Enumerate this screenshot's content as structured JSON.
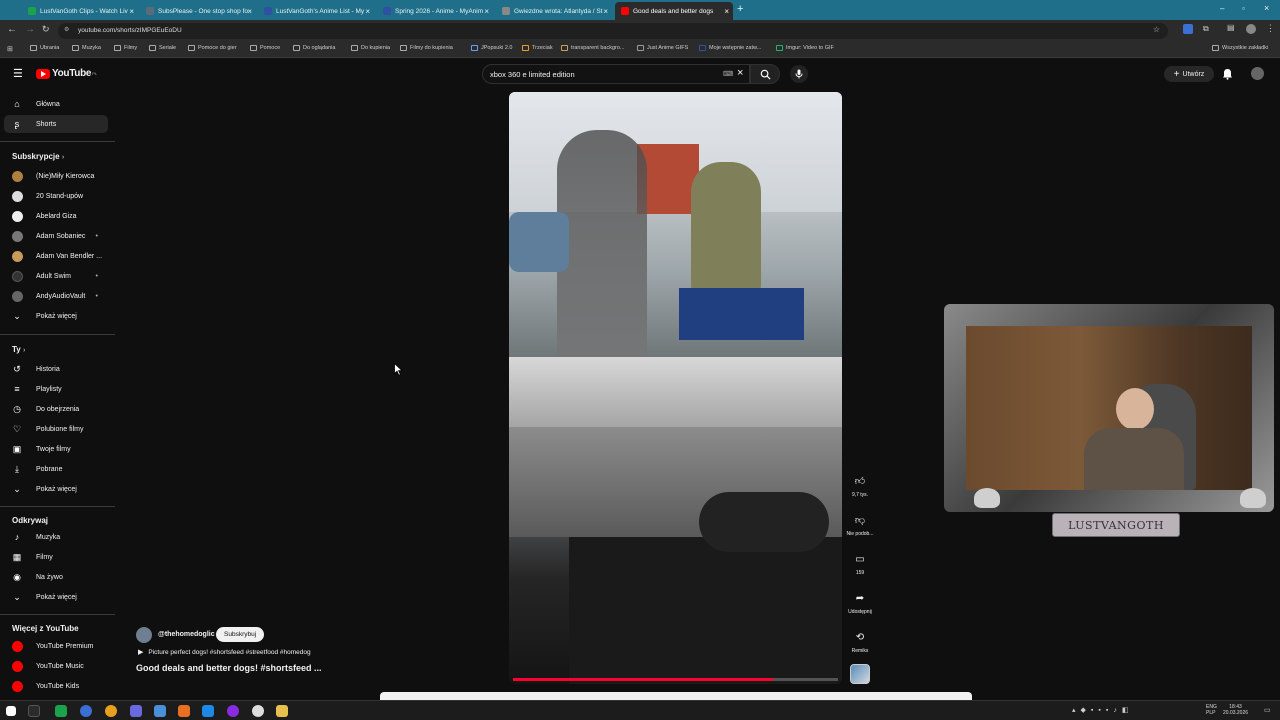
{
  "browser": {
    "tabs": [
      {
        "label": "LustVanGoth Clips - Watch Liv",
        "color": "#1aa34a"
      },
      {
        "label": "SubsPlease - One stop shop fo",
        "color": "#5a6b7a"
      },
      {
        "label": "LustVanGoth's Anime List - My",
        "color": "#2e51a2"
      },
      {
        "label": "Spring 2026 - Anime - MyAnim",
        "color": "#2e51a2"
      },
      {
        "label": "Gwiezdne wrota: Atlantyda / St",
        "color": "#888888"
      },
      {
        "label": "Good deals and better dogs",
        "color": "#ff0000"
      }
    ],
    "new_tab": "+",
    "url": "youtube.com/shorts/zIMPGEuEoDU",
    "bookmarks": [
      "Ubrania",
      "Muzyka",
      "Filmy",
      "Seriale",
      "Pomoce do gier",
      "Pomoce",
      "Do oglądania",
      "Do kupienia",
      "Filmy do kupienia",
      "JPopsuki 2.0",
      "Trzeciak",
      "transparent backgro...",
      "Just Anime GIFS",
      "Moje wstępnie zatw...",
      "Imgur: Video to GIF"
    ],
    "all_bookmarks": "Wszystkie zakładki"
  },
  "youtube": {
    "logo": "YouTube",
    "country": "PL",
    "search_value": "xbox 360 e limited edition",
    "create_label": "Utwórz"
  },
  "sidebar": {
    "main": [
      {
        "label": "Główna",
        "icon": "home-icon"
      },
      {
        "label": "Shorts",
        "icon": "shorts-icon"
      }
    ],
    "subs_title": "Subskrypcje",
    "subs": [
      {
        "label": "(Nie)Miły Kierowca",
        "color": "#b08040",
        "dot": false
      },
      {
        "label": "20 Stand-upów",
        "color": "#dddddd",
        "dot": false
      },
      {
        "label": "Abelard Giza",
        "color": "#eeeeee",
        "dot": false
      },
      {
        "label": "Adam Sobaniec",
        "color": "#777777",
        "dot": true
      },
      {
        "label": "Adam Van Bendler ...",
        "color": "#c89a5a",
        "dot": false
      },
      {
        "label": "Adult Swim",
        "color": "#333333",
        "dot": true
      },
      {
        "label": "AndyAudioVault",
        "color": "#666666",
        "dot": true
      }
    ],
    "show_more": "Pokaż więcej",
    "you_title": "Ty",
    "you": [
      {
        "label": "Historia",
        "icon": "history-icon"
      },
      {
        "label": "Playlisty",
        "icon": "playlist-icon"
      },
      {
        "label": "Do obejrzenia",
        "icon": "watch-later-icon"
      },
      {
        "label": "Polubione filmy",
        "icon": "like-icon"
      },
      {
        "label": "Twoje filmy",
        "icon": "your-videos-icon"
      },
      {
        "label": "Pobrane",
        "icon": "download-icon"
      }
    ],
    "explore_title": "Odkrywaj",
    "explore": [
      {
        "label": "Muzyka",
        "icon": "music-icon"
      },
      {
        "label": "Filmy",
        "icon": "movies-icon"
      },
      {
        "label": "Na żywo",
        "icon": "live-icon"
      }
    ],
    "more_title": "Więcej z YouTube",
    "more": [
      {
        "label": "YouTube Premium"
      },
      {
        "label": "YouTube Music"
      },
      {
        "label": "YouTube Kids"
      }
    ]
  },
  "short": {
    "channel": "@thehomedoglic",
    "subscribe": "Subskrybuj",
    "playlist": "Picture perfect dogs! #shortsfeed #streetfood #homedog",
    "title": "Good deals and better dogs! #shortsfeed ...",
    "likes": "9,7 tys.",
    "dislike": "Nie podob...",
    "comments": "159",
    "share": "Udostępnij",
    "remix": "Remiks",
    "progress": 0.8
  },
  "overlay": {
    "name": "LUSTVANGOTH"
  },
  "tray": {
    "lang": "ENG",
    "region": "PLP",
    "time": "18:43",
    "date": "20.03.2026"
  }
}
